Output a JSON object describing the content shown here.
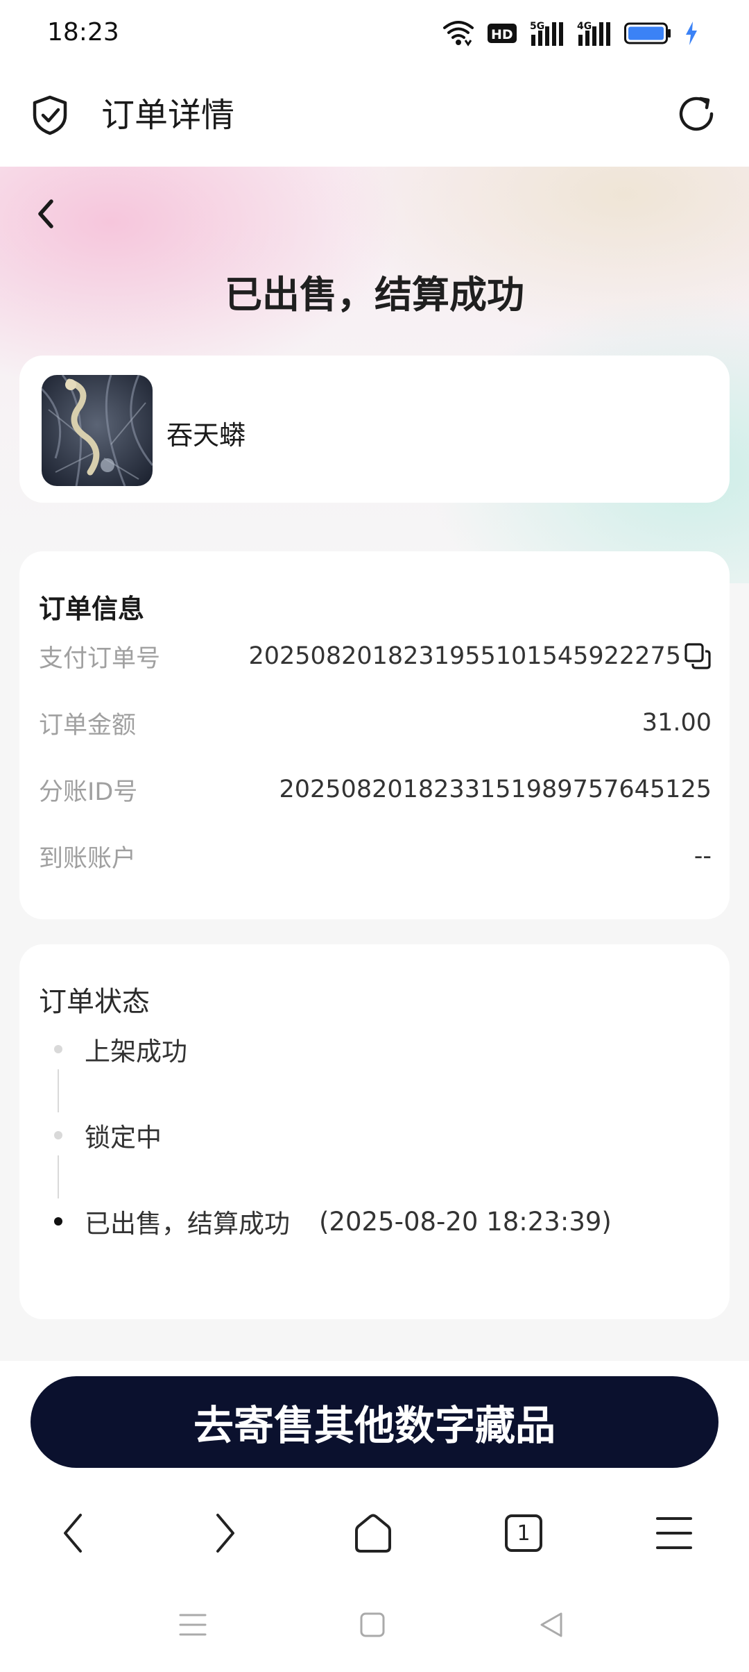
{
  "status_bar": {
    "time": "18:23",
    "icons": [
      "wifi-icon",
      "hd-icon",
      "signal-5g-icon",
      "signal-4g-icon",
      "battery-icon",
      "charging-icon"
    ],
    "hd_label": "HD",
    "net1": "5G",
    "net2": "4G"
  },
  "app_header": {
    "title": "订单详情",
    "icons": [
      "shield-icon",
      "refresh-icon"
    ]
  },
  "page": {
    "status_title": "已出售，结算成功"
  },
  "product": {
    "name": "吞天蟒"
  },
  "order_info": {
    "title": "订单信息",
    "rows": [
      {
        "label": "支付订单号",
        "value": "20250820182319551015459222​75"
      },
      {
        "label": "订单金额",
        "value": "31.00"
      },
      {
        "label": "分账ID号",
        "value": "202508201823315198975764​5125"
      },
      {
        "label": "到账账户",
        "value": "--"
      }
    ]
  },
  "order_status": {
    "title": "订单状态",
    "steps": [
      {
        "label": "上架成功",
        "time": "",
        "active": false
      },
      {
        "label": "锁定中",
        "time": "",
        "active": false
      },
      {
        "label": "已出售，结算成功",
        "time": "(2025-08-20 18:23:39)",
        "active": true
      }
    ]
  },
  "cta": {
    "label": "去寄售其他数字藏品"
  },
  "browser_bar": {
    "tab_count": "1",
    "icons": [
      "back-arrow-icon",
      "forward-arrow-icon",
      "home-icon",
      "tabs-icon",
      "menu-icon"
    ]
  },
  "system_nav": {
    "icons": [
      "recents-icon",
      "home-square-icon",
      "back-triangle-icon"
    ]
  },
  "colors": {
    "cta_bg": "#0b112e",
    "label_gray": "#a0a0a0",
    "battery_blue": "#3b82f6"
  }
}
